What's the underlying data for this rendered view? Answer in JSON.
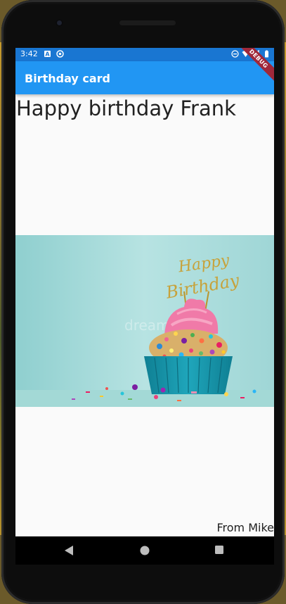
{
  "status_bar": {
    "time": "3:42",
    "icons": [
      "a-badge-icon",
      "sync-icon",
      "dnd-icon",
      "wifi-icon",
      "signal-icon",
      "battery-icon"
    ]
  },
  "app_bar": {
    "title": "Birthday card",
    "debug_banner": "DEBUG"
  },
  "content": {
    "greeting": "Happy birthday Frank",
    "image": {
      "subject": "cupcake-with-happy-birthday-topper",
      "topper_text": "Happy Birthday",
      "watermark": "dreams"
    },
    "signature": "From Mike"
  },
  "nav_bar": {
    "buttons": [
      "back-icon",
      "home-icon",
      "recents-icon"
    ]
  },
  "colors": {
    "status_bar": "#1976d2",
    "app_bar": "#2196f3",
    "background": "#fafafa",
    "image_bg": "#a9dcdb",
    "cupcake_wrapper": "#1a9bb0",
    "frosting": "#f07aa8",
    "topper": "#b8942c"
  }
}
